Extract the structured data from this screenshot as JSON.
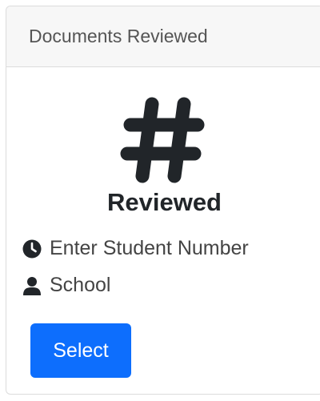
{
  "card": {
    "header_title": "Documents Reviewed",
    "icon": "hash-icon",
    "title": "Reviewed",
    "rows": [
      {
        "icon": "clock-icon",
        "text": "Enter Student Number"
      },
      {
        "icon": "user-icon",
        "text": "School"
      }
    ],
    "button_label": "Select"
  },
  "colors": {
    "primary": "#0d6efd",
    "header_bg": "#f7f7f7",
    "border": "#dcdcdc",
    "text_dark": "#212529",
    "text_muted": "#555555"
  }
}
